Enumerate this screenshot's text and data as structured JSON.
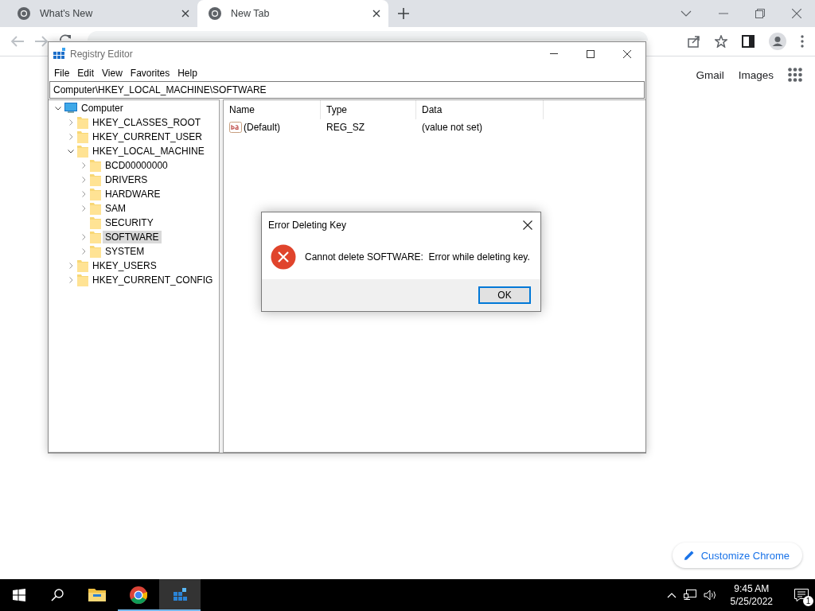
{
  "browser": {
    "tabs": [
      {
        "title": "What's New",
        "selected": false
      },
      {
        "title": "New Tab",
        "selected": true
      }
    ],
    "links": [
      "Gmail",
      "Images"
    ],
    "customize_button": "Customize Chrome"
  },
  "registry_editor": {
    "title": "Registry Editor",
    "menu": [
      "File",
      "Edit",
      "View",
      "Favorites",
      "Help"
    ],
    "address": "Computer\\HKEY_LOCAL_MACHINE\\SOFTWARE",
    "tree": [
      {
        "label": "Computer",
        "kind": "computer",
        "expandable": true,
        "expanded": true,
        "selected": false,
        "children": [
          {
            "label": "HKEY_CLASSES_ROOT",
            "kind": "folder",
            "expandable": true,
            "expanded": false,
            "selected": false
          },
          {
            "label": "HKEY_CURRENT_USER",
            "kind": "folder",
            "expandable": true,
            "expanded": false,
            "selected": false
          },
          {
            "label": "HKEY_LOCAL_MACHINE",
            "kind": "folder",
            "expandable": true,
            "expanded": true,
            "selected": false,
            "children": [
              {
                "label": "BCD00000000",
                "kind": "folder",
                "expandable": true,
                "expanded": false,
                "selected": false
              },
              {
                "label": "DRIVERS",
                "kind": "folder",
                "expandable": true,
                "expanded": false,
                "selected": false
              },
              {
                "label": "HARDWARE",
                "kind": "folder",
                "expandable": true,
                "expanded": false,
                "selected": false
              },
              {
                "label": "SAM",
                "kind": "folder",
                "expandable": true,
                "expanded": false,
                "selected": false
              },
              {
                "label": "SECURITY",
                "kind": "folder",
                "expandable": false,
                "selected": false
              },
              {
                "label": "SOFTWARE",
                "kind": "folder",
                "expandable": true,
                "expanded": false,
                "selected": true
              },
              {
                "label": "SYSTEM",
                "kind": "folder",
                "expandable": true,
                "expanded": false,
                "selected": false
              }
            ]
          },
          {
            "label": "HKEY_USERS",
            "kind": "folder",
            "expandable": true,
            "expanded": false,
            "selected": false
          },
          {
            "label": "HKEY_CURRENT_CONFIG",
            "kind": "folder",
            "expandable": true,
            "expanded": false,
            "selected": false
          }
        ]
      }
    ],
    "columns": [
      "Name",
      "Type",
      "Data"
    ],
    "rows": [
      {
        "name": "(Default)",
        "type": "REG_SZ",
        "data": "(value not set)"
      }
    ]
  },
  "dialog": {
    "title": "Error Deleting Key",
    "message": "Cannot delete SOFTWARE:  Error while deleting key.",
    "buttons": [
      "OK"
    ]
  },
  "taskbar": {
    "items": [
      {
        "kind": "explorer",
        "running": false,
        "active": false
      },
      {
        "kind": "chrome",
        "running": true,
        "active": false
      },
      {
        "kind": "regedit",
        "running": true,
        "active": true
      }
    ],
    "time": "9:45 AM",
    "date": "5/25/2022",
    "notification_count": "1"
  }
}
